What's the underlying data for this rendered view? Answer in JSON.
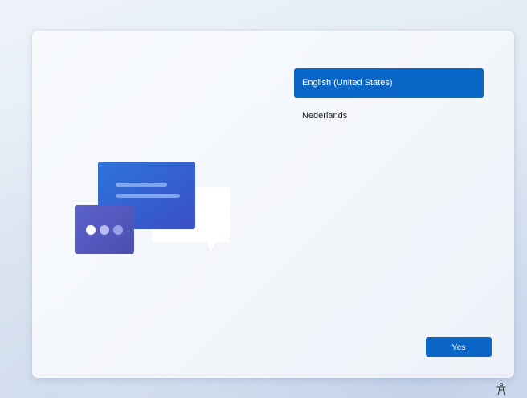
{
  "languages": [
    {
      "label": "English (United States)",
      "selected": true
    },
    {
      "label": "Nederlands",
      "selected": false
    }
  ],
  "actions": {
    "yes_label": "Yes"
  },
  "icons": {
    "illustration": "chat-bubbles-illustration",
    "accessibility": "accessibility-icon"
  },
  "colors": {
    "accent": "#0a67c7",
    "card_background": "#f6f8fc"
  }
}
